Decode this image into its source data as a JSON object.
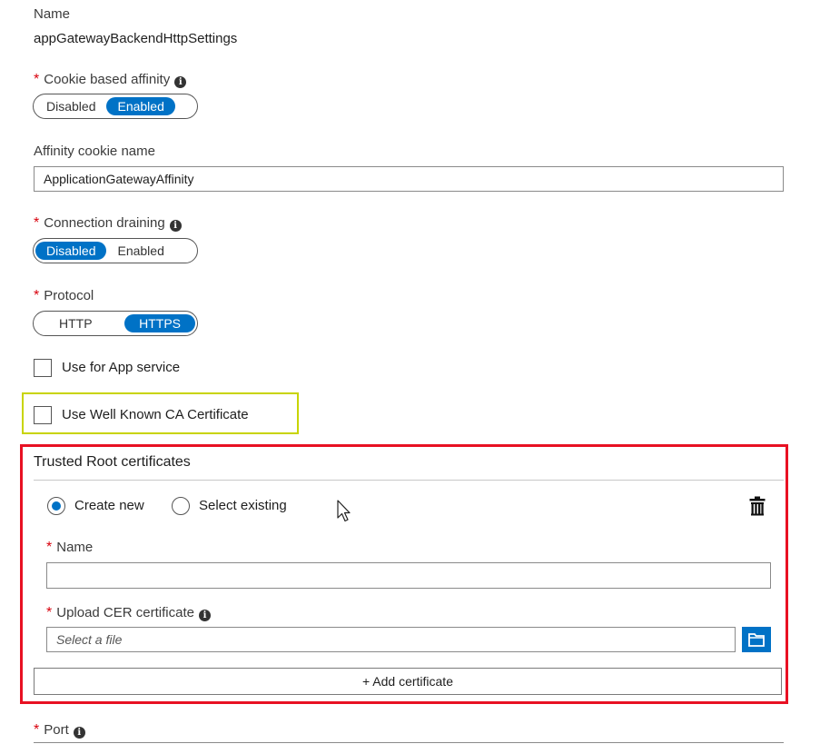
{
  "fields": {
    "name": {
      "label": "Name",
      "value": "appGatewayBackendHttpSettings"
    },
    "cookie_affinity": {
      "label": "Cookie based affinity",
      "options": [
        "Disabled",
        "Enabled"
      ],
      "selected": "Enabled"
    },
    "affinity_cookie_name": {
      "label": "Affinity cookie name",
      "value": "ApplicationGatewayAffinity"
    },
    "connection_draining": {
      "label": "Connection draining",
      "options": [
        "Disabled",
        "Enabled"
      ],
      "selected": "Disabled"
    },
    "protocol": {
      "label": "Protocol",
      "options": [
        "HTTP",
        "HTTPS"
      ],
      "selected": "HTTPS"
    },
    "use_app_service": {
      "label": "Use for App service",
      "checked": false
    },
    "use_well_known_ca": {
      "label": "Use Well Known CA Certificate",
      "checked": false
    },
    "port": {
      "label": "Port"
    }
  },
  "trusted_root": {
    "title": "Trusted Root certificates",
    "radio_create_new": "Create new",
    "radio_select_existing": "Select existing",
    "selected_radio": "Create new",
    "name_label": "Name",
    "name_value": "",
    "upload_label": "Upload CER certificate",
    "upload_placeholder": "Select a file",
    "add_button": "+ Add certificate"
  },
  "icons": {
    "info": "info-icon",
    "delete": "trash-icon",
    "folder": "folder-icon",
    "cursor": "mouse-cursor-icon"
  },
  "colors": {
    "accent": "#0072c6",
    "required": "#d8000c",
    "highlight_yellow": "#c8d400",
    "highlight_red": "#e81123"
  }
}
